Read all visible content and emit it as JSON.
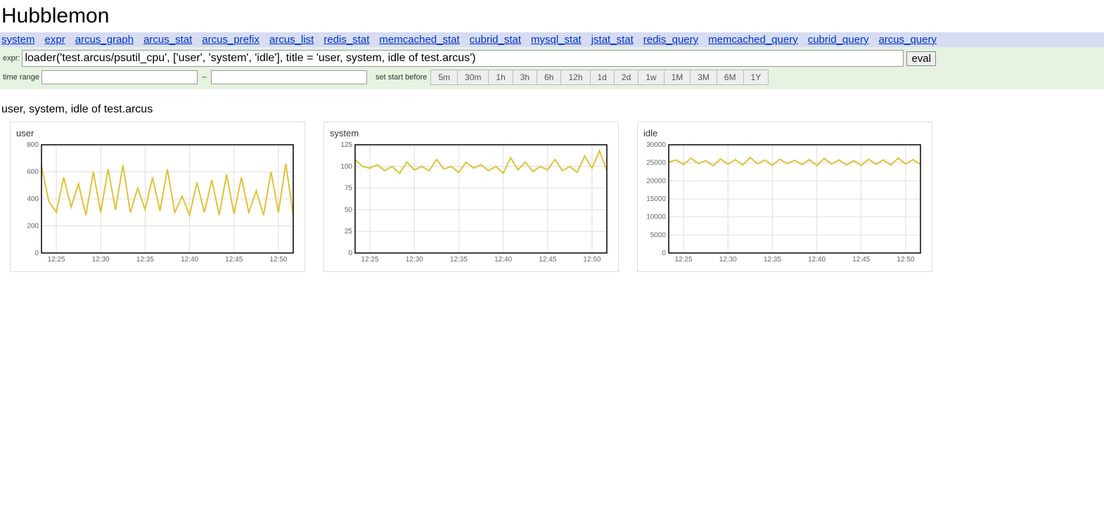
{
  "header": {
    "title": "Hubblemon"
  },
  "nav": {
    "links": [
      "system",
      "expr",
      "arcus_graph",
      "arcus_stat",
      "arcus_prefix",
      "arcus_list",
      "redis_stat",
      "memcached_stat",
      "cubrid_stat",
      "mysql_stat",
      "jstat_stat",
      "redis_query",
      "memcached_query",
      "cubrid_query",
      "arcus_query"
    ]
  },
  "expr_form": {
    "label": "expr:",
    "value": "loader('test.arcus/psutil_cpu', ['user', 'system', 'idle'], title = 'user, system, idle of test.arcus')",
    "eval_label": "eval"
  },
  "time_range": {
    "label": "time range",
    "start_value": "",
    "end_value": "",
    "separator": "~",
    "before_label": "set start before",
    "presets": [
      "5m",
      "30m",
      "1h",
      "3h",
      "6h",
      "12h",
      "1d",
      "2d",
      "1w",
      "1M",
      "3M",
      "6M",
      "1Y"
    ]
  },
  "section_title": "user, system, idle of test.arcus",
  "chart_data": [
    {
      "type": "line",
      "title": "user",
      "xlabel": "",
      "ylabel": "",
      "ylim": [
        0,
        800
      ],
      "yticks": [
        0,
        200,
        400,
        600,
        800
      ],
      "xlim_min": 0,
      "xlim_max": 34,
      "xticks_idx": [
        2,
        8,
        14,
        20,
        26,
        32
      ],
      "xticks_label": [
        "12:25",
        "12:30",
        "12:35",
        "12:40",
        "12:45",
        "12:50"
      ],
      "values": [
        640,
        380,
        300,
        560,
        340,
        510,
        280,
        600,
        300,
        620,
        320,
        650,
        300,
        480,
        320,
        560,
        310,
        620,
        300,
        420,
        280,
        520,
        300,
        540,
        280,
        580,
        290,
        560,
        300,
        460,
        280,
        600,
        300,
        660,
        280
      ]
    },
    {
      "type": "line",
      "title": "system",
      "xlabel": "",
      "ylabel": "",
      "ylim": [
        0,
        125
      ],
      "yticks": [
        0,
        25,
        50,
        75,
        100,
        125
      ],
      "xlim_min": 0,
      "xlim_max": 34,
      "xticks_idx": [
        2,
        8,
        14,
        20,
        26,
        32
      ],
      "xticks_label": [
        "12:25",
        "12:30",
        "12:35",
        "12:40",
        "12:45",
        "12:50"
      ],
      "values": [
        108,
        100,
        98,
        102,
        95,
        100,
        92,
        105,
        96,
        100,
        95,
        108,
        97,
        100,
        93,
        105,
        98,
        102,
        95,
        100,
        92,
        110,
        96,
        105,
        94,
        100,
        96,
        108,
        95,
        100,
        93,
        112,
        98,
        118,
        95
      ]
    },
    {
      "type": "line",
      "title": "idle",
      "xlabel": "",
      "ylabel": "",
      "ylim": [
        0,
        30000
      ],
      "yticks": [
        0,
        5000,
        10000,
        15000,
        20000,
        25000,
        30000
      ],
      "xlim_min": 0,
      "xlim_max": 34,
      "xticks_idx": [
        2,
        8,
        14,
        20,
        26,
        32
      ],
      "xticks_label": [
        "12:25",
        "12:30",
        "12:35",
        "12:40",
        "12:45",
        "12:50"
      ],
      "values": [
        25200,
        25800,
        24500,
        26300,
        24800,
        25600,
        24200,
        26100,
        24600,
        25900,
        24400,
        26500,
        24700,
        25800,
        24300,
        26000,
        24800,
        25700,
        24500,
        25900,
        24200,
        26200,
        24700,
        25800,
        24400,
        25600,
        24300,
        26000,
        24600,
        25800,
        24400,
        26300,
        24700,
        25900,
        24500
      ]
    }
  ]
}
